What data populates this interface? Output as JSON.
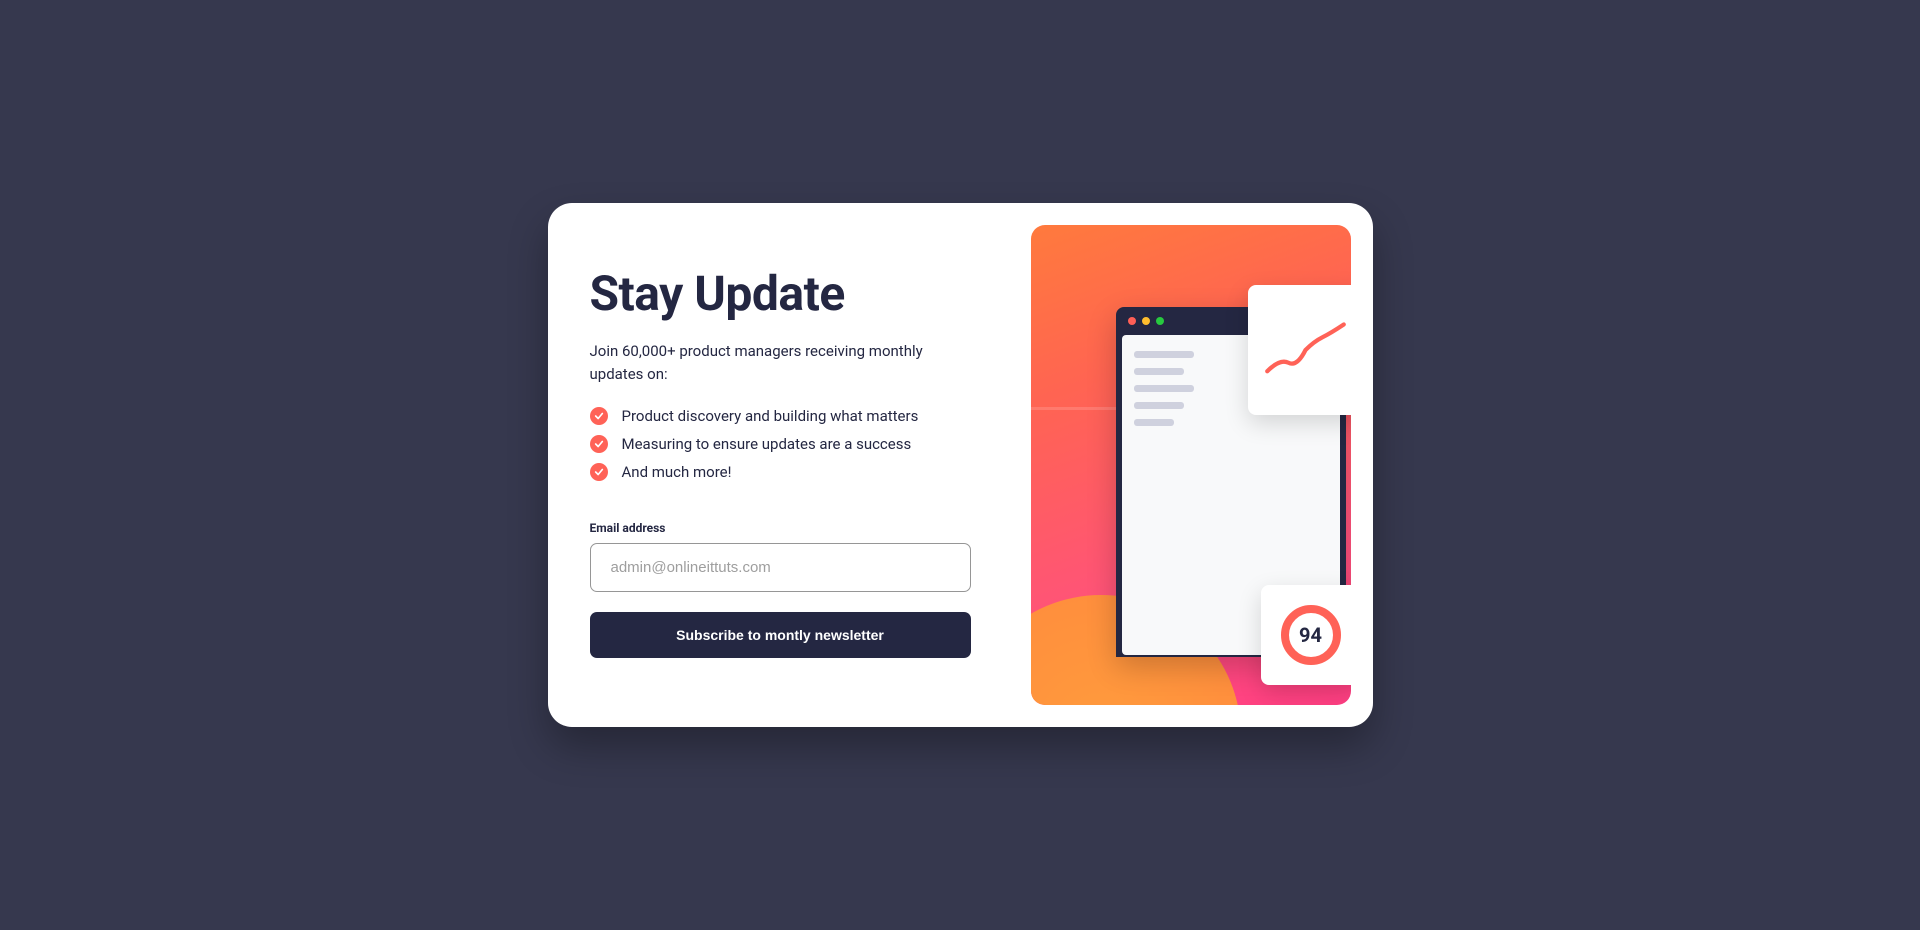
{
  "card": {
    "title": "Stay Update",
    "subtitle": "Join 60,000+ product managers receiving monthly updates on:",
    "list": [
      "Product discovery and building what matters",
      "Measuring to ensure updates are a success",
      "And much more!"
    ],
    "form": {
      "label": "Email address",
      "placeholder": "admin@onlineittuts.com",
      "button": "Subscribe to montly newsletter"
    },
    "illustration": {
      "score": "94"
    }
  }
}
